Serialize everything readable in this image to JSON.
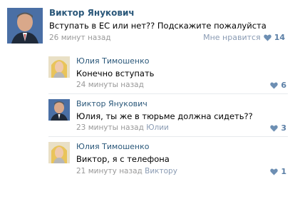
{
  "post": {
    "author": "Виктор Янукович",
    "text": "Вступать в ЕС или нет?? Подскажите пожалуйста",
    "time": "26 минут назад",
    "like_label": "Мне нравится",
    "likes": "14",
    "avatar_icon": "yanukovych-avatar"
  },
  "comments": [
    {
      "author": "Юлия Тимошенко",
      "text": "Конечно вступать",
      "time": "24 минуты назад",
      "reply_to": "",
      "likes": "6",
      "avatar_icon": "tymoshenko-avatar"
    },
    {
      "author": "Виктор Янукович",
      "text": "Юлия, ты же в тюрьме должна сидеть??",
      "time": "23 минуты назад",
      "reply_to": "Юлии",
      "likes": "3",
      "avatar_icon": "yanukovych-avatar"
    },
    {
      "author": "Юлия Тимошенко",
      "text": "Виктор, я с телефона",
      "time": "21 минуту назад",
      "reply_to": "Виктору",
      "likes": "1",
      "avatar_icon": "tymoshenko-avatar"
    }
  ],
  "colors": {
    "link": "#2b587a",
    "muted": "#999999",
    "heart": "#6d8fb3"
  }
}
